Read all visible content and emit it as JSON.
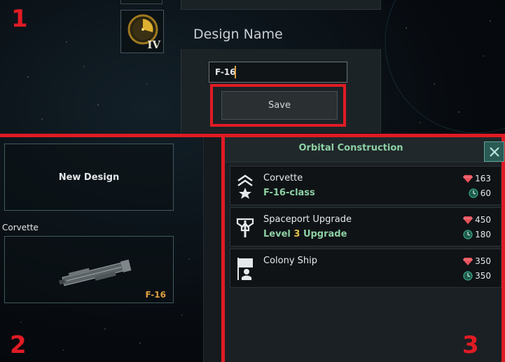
{
  "top": {
    "tech_level": "IV",
    "design_name_label": "Design Name",
    "design_name_value": "F-16",
    "save_label": "Save"
  },
  "regions": [
    "1",
    "2",
    "3"
  ],
  "designs": {
    "new_design_label": "New Design",
    "class_heading": "Corvette",
    "ship_card_name": "F-16"
  },
  "orbital": {
    "title": "Orbital Construction",
    "items": [
      {
        "name": "Corvette",
        "sub": "F-16-class",
        "mineral_cost": "163",
        "time_cost": "60",
        "icon": "corvette-chevrons-icon"
      },
      {
        "name": "Spaceport Upgrade",
        "sub_prefix": "Level ",
        "sub_level": "3",
        "sub_suffix": " Upgrade",
        "mineral_cost": "450",
        "time_cost": "180",
        "icon": "spaceport-icon"
      },
      {
        "name": "Colony Ship",
        "sub": "",
        "mineral_cost": "350",
        "time_cost": "350",
        "icon": "colony-flag-icon"
      }
    ]
  },
  "colors": {
    "highlight_red": "#e01b24",
    "green_text": "#8ed0a4",
    "orange_text": "#e0a040",
    "mineral_red": "#e8505a",
    "time_teal": "#3aa888"
  }
}
